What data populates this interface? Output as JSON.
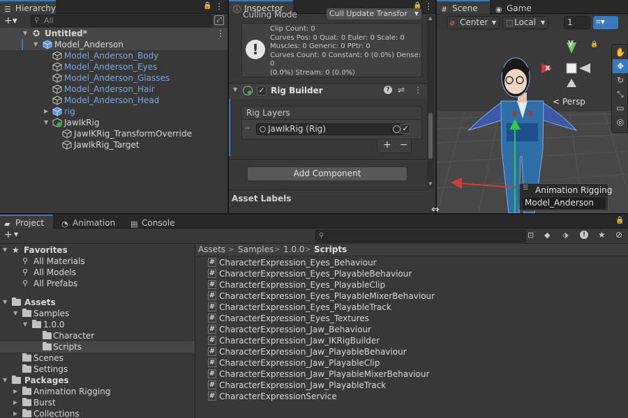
{
  "hierarchy": {
    "tab_label": "Hierarchy",
    "search_placeholder": "All",
    "items": [
      {
        "label": "Untitled*"
      },
      {
        "label": "Model_Anderson"
      },
      {
        "label": "Model_Anderson_Body"
      },
      {
        "label": "Model_Anderson_Eyes"
      },
      {
        "label": "Model_Anderson_Glasses"
      },
      {
        "label": "Model_Anderson_Hair"
      },
      {
        "label": "Model_Anderson_Head"
      },
      {
        "label": "rig"
      },
      {
        "label": "JawIkRig"
      },
      {
        "label": "JawIKRig_TransformOverride"
      },
      {
        "label": "JawIkRig_Target"
      }
    ]
  },
  "inspector": {
    "tab_label": "Inspector",
    "culling_label": "Culling Mode",
    "culling_value": "Cull Update Transfor",
    "info_lines": [
      "Clip Count: 0",
      "Curves Pos: 0 Quat: 0 Euler: 0 Scale: 0",
      "Muscles: 0 Generic: 0 PPtr: 0",
      "Curves Count: 0 Constant: 0 (0.0%) Dense: 0",
      "(0.0%) Stream: 0 (0.0%)"
    ],
    "rig_builder_title": "Rig Builder",
    "rig_layers_label": "Rig Layers",
    "rig_layer_item": "JawIkRig (Rig)",
    "add_label": "+",
    "remove_label": "−",
    "add_component_label": "Add Component",
    "asset_labels": "Asset Labels"
  },
  "scene": {
    "tab_scene": "Scene",
    "tab_game": "Game",
    "pivot_label": "Center",
    "space_label": "Local",
    "grid_value": "1",
    "persp_label": "< Persp",
    "axis_x": "x",
    "axis_y": "y",
    "overlay_title": "Animation Rigging",
    "overlay_value": "Model_Anderson"
  },
  "project": {
    "tab_project": "Project",
    "tab_animation": "Animation",
    "tab_console": "Console",
    "add_label": "+",
    "tree": [
      {
        "label": "Favorites"
      },
      {
        "label": "All Materials"
      },
      {
        "label": "All Models"
      },
      {
        "label": "All Prefabs"
      },
      {
        "label": "Assets"
      },
      {
        "label": "Samples"
      },
      {
        "label": "1.0.0"
      },
      {
        "label": "Character"
      },
      {
        "label": "Scripts"
      },
      {
        "label": "Scenes"
      },
      {
        "label": "Settings"
      },
      {
        "label": "Packages"
      },
      {
        "label": "Animation Rigging"
      },
      {
        "label": "Burst"
      },
      {
        "label": "Collections"
      }
    ],
    "breadcrumb": [
      "Assets",
      "Samples",
      "1.0.0",
      "Scripts"
    ],
    "breadcrumb_sep": ">",
    "files": [
      "CharacterExpression_Eyes_Behaviour",
      "CharacterExpression_Eyes_PlayableBehaviour",
      "CharacterExpression_Eyes_PlayableClip",
      "CharacterExpression_Eyes_PlayableMixerBehaviour",
      "CharacterExpression_Eyes_PlayableTrack",
      "CharacterExpression_Eyes_Textures",
      "CharacterExpression_Jaw_Behaviour",
      "CharacterExpression_Jaw_IKRigBuilder",
      "CharacterExpression_Jaw_PlayableBehaviour",
      "CharacterExpression_Jaw_PlayableClip",
      "CharacterExpression_Jaw_PlayableMixerBehaviour",
      "CharacterExpression_Jaw_PlayableTrack",
      "CharacterExpressionService"
    ],
    "script_glyph": "#"
  },
  "colors": {
    "selection": "#2c5d87",
    "accent": "#3a79bb",
    "prefab_blue": "#7ba6e0",
    "panel_bg": "#383838"
  }
}
